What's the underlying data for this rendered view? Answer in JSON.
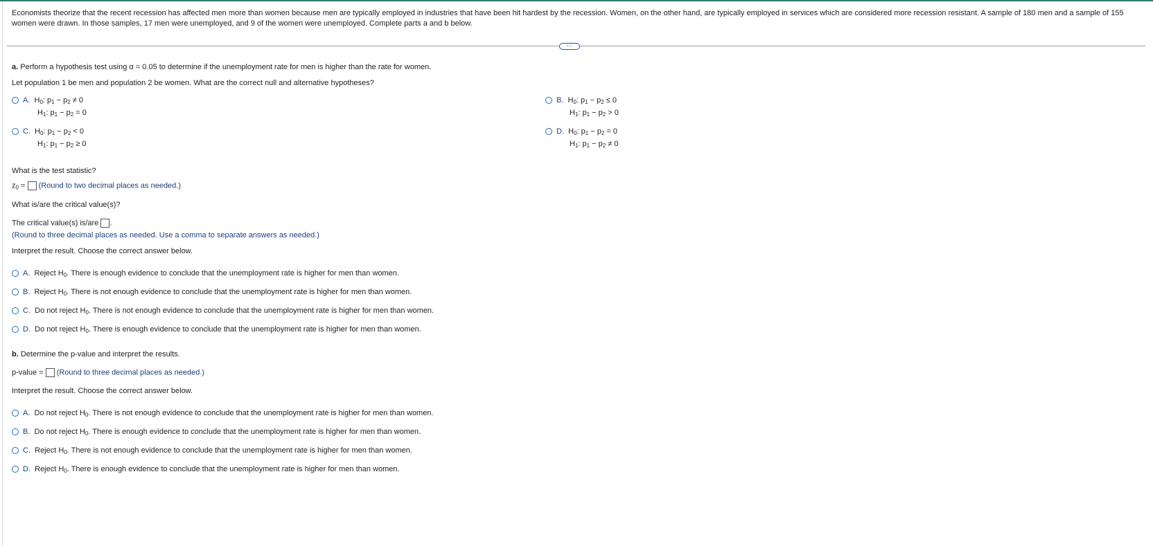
{
  "intro": "Economists theorize that the recent recession has affected men more than women because men are typically employed in industries that have been hit hardest by the recession. Women, on the other hand, are typically employed in services which are considered more recession resistant. A sample of 180 men and a sample of 155 women were drawn. In those samples, 17 men were unemployed, and 9 of the women were unemployed. Complete parts a and b below.",
  "more_button": "⋯",
  "part_a": {
    "label": "a.",
    "prompt": "Perform a hypothesis test using α = 0.05 to determine if the unemployment rate for men is higher than the rate for women.",
    "hyp_question": "Let population 1 be men and population 2 be women. What are the correct null and alternative hypotheses?",
    "hypotheses": [
      {
        "letter": "A.",
        "h0": "≠ 0",
        "h1": "= 0"
      },
      {
        "letter": "B.",
        "h0": "≤ 0",
        "h1": "> 0"
      },
      {
        "letter": "C.",
        "h0": "< 0",
        "h1": "≥ 0"
      },
      {
        "letter": "D.",
        "h0": "= 0",
        "h1": "≠ 0"
      }
    ],
    "test_stat_q": "What is the test statistic?",
    "test_stat_label": "z",
    "test_stat_sub": "0",
    "test_stat_hint": "(Round to two decimal places as needed.)",
    "crit_q": "What is/are the critical value(s)?",
    "crit_label": "The critical value(s) is/are",
    "crit_hint": "(Round to three decimal places as needed. Use a comma to separate answers as needed.)",
    "interp_q": "Interpret the result. Choose the correct answer below.",
    "interp_options": [
      {
        "letter": "A.",
        "decision": "Reject H",
        "text": ". There is enough evidence to conclude that the unemployment rate is higher for men than women."
      },
      {
        "letter": "B.",
        "decision": "Reject H",
        "text": ". There is not enough evidence to conclude that the unemployment rate is higher for men than women."
      },
      {
        "letter": "C.",
        "decision": "Do not reject H",
        "text": ". There is not enough evidence to conclude that the unemployment rate is higher for men than women."
      },
      {
        "letter": "D.",
        "decision": "Do not reject H",
        "text": ". There is enough evidence to conclude that the unemployment rate is higher for men than women."
      }
    ]
  },
  "part_b": {
    "label": "b.",
    "prompt": "Determine the p-value and interpret the results.",
    "pvalue_label": "p-value =",
    "pvalue_hint": "(Round to three decimal places as needed.)",
    "interp_q": "Interpret the result. Choose the correct answer below.",
    "interp_options": [
      {
        "letter": "A.",
        "decision": "Do not reject H",
        "text": ". There is not enough evidence to conclude that the unemployment rate is higher for men than women."
      },
      {
        "letter": "B.",
        "decision": "Do not reject H",
        "text": ". There is enough evidence to conclude that the unemployment rate is higher for men than women."
      },
      {
        "letter": "C.",
        "decision": "Reject H",
        "text": ". There is not enough evidence to conclude that the unemployment rate is higher for men than women."
      },
      {
        "letter": "D.",
        "decision": "Reject H",
        "text": ". There is enough evidence to conclude that the unemployment rate is higher for men than women."
      }
    ]
  }
}
